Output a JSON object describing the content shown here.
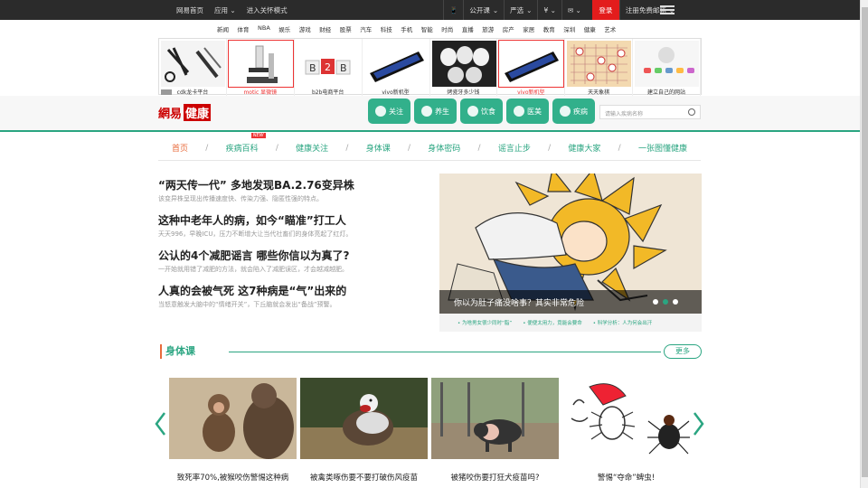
{
  "topbar": {
    "left": [
      "网易首页",
      "应用",
      "进入关怀模式"
    ],
    "right": [
      "公开课",
      "严选",
      "",
      "",
      "登录",
      "注册免费邮箱"
    ]
  },
  "channels": [
    "新闻",
    "体育",
    "NBA",
    "娱乐",
    "游戏",
    "财经",
    "股票",
    "汽车",
    "科技",
    "手机",
    "智能",
    "时尚",
    "直播",
    "旅游",
    "房产",
    "家居",
    "教育",
    "深圳",
    "健康",
    "艺术"
  ],
  "ads": [
    {
      "caption": "cdk龙卡平台",
      "selected": false
    },
    {
      "caption": "motic 显微镜",
      "selected": true
    },
    {
      "caption": "b2b电商平台",
      "selected": false
    },
    {
      "caption": "vivo新机型",
      "selected": false
    },
    {
      "caption": "烤瓷牙多少钱",
      "selected": false
    },
    {
      "caption": "vivo新机型",
      "selected": true
    },
    {
      "caption": "天天象棋",
      "selected": false
    },
    {
      "caption": "建立自己的网站",
      "selected": false
    }
  ],
  "logo": {
    "brand": "網易",
    "section": "健康"
  },
  "header_buttons": [
    "关注",
    "养生",
    "饮食",
    "医美",
    "疾病"
  ],
  "search": {
    "placeholder": "请输入疾病名称"
  },
  "nav": {
    "items": [
      "首页",
      "疾病百科",
      "健康关注",
      "身体课",
      "身体密码",
      "谣言止步",
      "健康大家",
      "一张图懂健康"
    ],
    "badge": "NEW"
  },
  "articles": [
    {
      "title": "“两天传一代” 多地发现BA.2.76变异株",
      "summary": "该变异株呈现出传播速度快、传染力强、隐匿性强的特点。"
    },
    {
      "title": "这种中老年人的病，如今“瞄准”打工人",
      "summary": "天天996，早晚ICU，压力不断增大让当代社畜们的身体亮起了红灯。"
    },
    {
      "title": "公认的4个减肥谣言 哪些你信以为真了?",
      "summary": "一开始就用错了减肥的方法，就会陷入了减肥误区，才会越减越肥。"
    },
    {
      "title": "人真的会被气死 这7种病是“气”出来的",
      "summary": "当怒意触发大脑中的“情绪开关”，下丘脑就会发出“备战”预警。"
    }
  ],
  "slideshow": {
    "caption": "你以为肚子痛没啥事？其实非常危险",
    "dots": 3,
    "active_dot": 2,
    "links": [
      "为啥男女很少同时“脂”",
      "便便太用力，竟能会要命",
      "科学分析：人为何会出汗"
    ]
  },
  "section": {
    "title": "身体课",
    "more": "更多"
  },
  "cards": [
    {
      "caption": "致死率70%,被猴咬伤警惕这种病"
    },
    {
      "caption": "被禽类啄伤要不要打破伤风疫苗"
    },
    {
      "caption": "被猪咬伤要打狂犬疫苗吗?"
    },
    {
      "caption": "警惕“夺命”蜱虫!"
    }
  ]
}
